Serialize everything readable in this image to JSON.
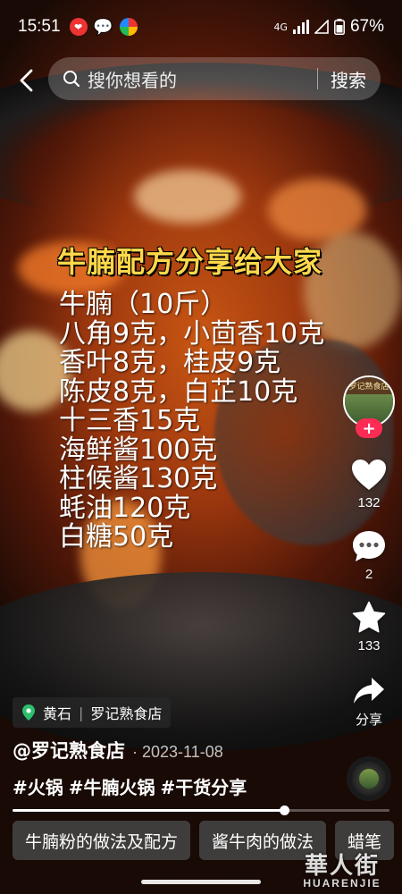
{
  "status_bar": {
    "time": "15:51",
    "battery_percent": "67%",
    "signal_text": "4G"
  },
  "search": {
    "placeholder": "搜你想看的",
    "button_label": "搜索"
  },
  "recipe": {
    "title": "牛腩配方分享给大家",
    "lines": [
      "牛腩（10斤）",
      "八角9克，小茴香10克",
      "香叶8克，桂皮9克",
      "陈皮8克，白芷10克",
      "十三香15克",
      "海鲜酱100克",
      "柱候酱130克",
      "蚝油120克",
      "白糖50克"
    ]
  },
  "creator": {
    "avatar_sign": "罗记熟食店",
    "follow_symbol": "+"
  },
  "actions": {
    "likes": "132",
    "comments": "2",
    "favorites": "133",
    "share_label": "分享"
  },
  "location": {
    "city": "黄石",
    "place": "罗记熟食店",
    "separator": "|"
  },
  "post": {
    "author": "@罗记熟食店",
    "date": "· 2023-11-08",
    "hashtags": [
      "#火锅",
      "#牛腩火锅",
      "#干货分享"
    ]
  },
  "progress": 0.72,
  "related_searches": [
    "牛腩粉的做法及配方",
    "酱牛肉的做法",
    "蜡笔"
  ],
  "watermark": {
    "cn": "華人街",
    "en": "HUARENJIE"
  },
  "colors": {
    "accent": "#fe2c55",
    "title_yellow": "#ffd84a",
    "location_pin": "#2dbf6c"
  },
  "icons": {
    "back": "chevron-left-icon",
    "search": "search-icon",
    "like": "heart-icon",
    "comment": "comment-icon",
    "favorite": "star-icon",
    "share": "share-arrow-icon",
    "location": "location-pin-icon"
  }
}
